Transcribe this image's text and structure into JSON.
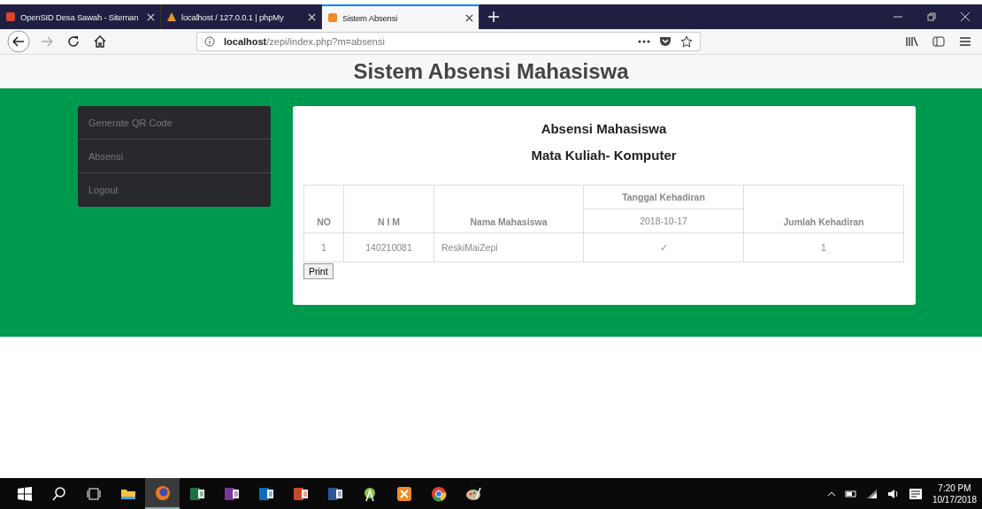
{
  "browser": {
    "tabs": [
      {
        "label": "OpenSID Desa Sawah - Siteman",
        "kind": "opensid",
        "selected": false
      },
      {
        "label": "localhost / 127.0.0.1 | phpMy",
        "kind": "pma",
        "selected": false
      },
      {
        "label": "Sistem Absensi",
        "kind": "xampp",
        "selected": true
      }
    ],
    "url": {
      "host": "localhost",
      "path": "/zepi/index.php?m=absensi"
    }
  },
  "page": {
    "title": "Sistem Absensi Mahasiswa",
    "sidebar": {
      "items": [
        "Generate QR Code",
        "Absensi",
        "Logout"
      ]
    },
    "card": {
      "heading": "Absensi Mahasiswa",
      "subheading": "Mata Kuliah- Komputer",
      "table": {
        "columns": [
          "NO",
          "N I M",
          "Nama Mahasiswa",
          "Tanggal Kehadiran",
          "Jumlah Kehadiran"
        ],
        "dates": [
          "2018-10-17"
        ],
        "rows": [
          {
            "no": "1",
            "nim": "140210081",
            "name": "ReskiMaiZepi",
            "marks": [
              "✓"
            ],
            "total": "1"
          }
        ]
      },
      "print_button": "Print"
    }
  },
  "taskbar": {
    "apps": [
      {
        "kind": "start",
        "selected": false
      },
      {
        "kind": "search",
        "selected": false
      },
      {
        "kind": "taskview",
        "selected": false
      },
      {
        "kind": "folder",
        "selected": false
      },
      {
        "kind": "firefox",
        "selected": true
      },
      {
        "kind": "excel",
        "selected": false
      },
      {
        "kind": "onenote",
        "selected": false
      },
      {
        "kind": "outlook",
        "selected": false
      },
      {
        "kind": "powerpoint",
        "selected": false
      },
      {
        "kind": "word",
        "selected": false
      },
      {
        "kind": "android",
        "selected": false
      },
      {
        "kind": "xampp",
        "selected": false
      },
      {
        "kind": "chrome",
        "selected": false
      },
      {
        "kind": "paint",
        "selected": false
      }
    ],
    "time": "7:20 PM",
    "date": "10/17/2018"
  }
}
